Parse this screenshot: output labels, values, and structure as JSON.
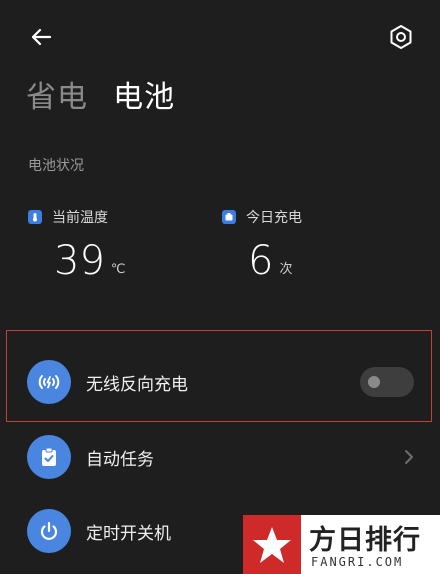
{
  "header": {
    "tabs": [
      {
        "label": "省电",
        "active": false
      },
      {
        "label": "电池",
        "active": true
      }
    ],
    "back_icon": "back-arrow-icon",
    "settings_icon": "gear-icon"
  },
  "battery_status": {
    "section_title": "电池状况",
    "temperature": {
      "label": "当前温度",
      "value": "39",
      "unit": "℃",
      "icon": "thermometer-icon"
    },
    "charges_today": {
      "label": "今日充电",
      "value": "6",
      "unit": "次",
      "icon": "battery-icon"
    }
  },
  "settings": [
    {
      "label": "无线反向充电",
      "icon": "wireless-charge-icon",
      "control": "toggle",
      "enabled": false
    },
    {
      "label": "自动任务",
      "icon": "clipboard-check-icon",
      "control": "chevron"
    },
    {
      "label": "定时开关机",
      "icon": "power-icon",
      "control": "none"
    }
  ],
  "watermark": {
    "title": "方日排行",
    "subtitle": "FANGRI.COM"
  },
  "colors": {
    "accent": "#4a86e0",
    "background": "#1e1e1e",
    "highlight": "#c0403a"
  }
}
